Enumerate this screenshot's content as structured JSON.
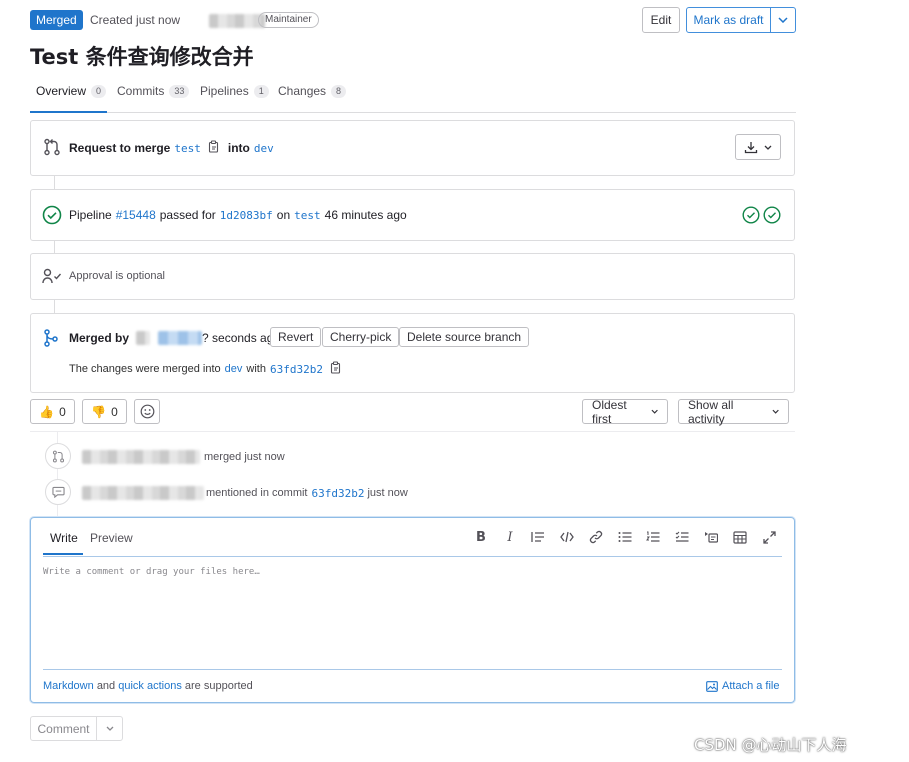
{
  "header": {
    "status_badge": "Merged",
    "created_text": "Created just now",
    "role_badge": "Maintainer",
    "edit_label": "Edit",
    "draft_label": "Mark as draft",
    "title": "Test 条件查询修改合并"
  },
  "tabs": [
    {
      "label": "Overview",
      "count": "0"
    },
    {
      "label": "Commits",
      "count": "33"
    },
    {
      "label": "Pipelines",
      "count": "1"
    },
    {
      "label": "Changes",
      "count": "8"
    }
  ],
  "merge_request": {
    "request_label": "Request to merge",
    "source_branch": "test",
    "into_label": "into",
    "target_branch": "dev"
  },
  "pipeline": {
    "label": "Pipeline",
    "id": "#15448",
    "passed_for": "passed for",
    "commit": "1d2083bf",
    "on": "on",
    "branch": "test",
    "time": "46 minutes ago"
  },
  "approval": {
    "text": "Approval is optional"
  },
  "merged": {
    "by_label": "Merged by",
    "time": "? seconds ago",
    "revert": "Revert",
    "cherry_pick": "Cherry-pick",
    "delete_branch": "Delete source branch",
    "changes_text": "The changes were merged into",
    "target_branch": "dev",
    "with": "with",
    "commit": "63fd32b2"
  },
  "reactions": {
    "thumbs_up": "0",
    "thumbs_down": "0",
    "sort_label": "Oldest first",
    "filter_label": "Show all activity"
  },
  "activity": [
    {
      "text": "merged just now"
    },
    {
      "text": "mentioned in commit",
      "commit": "63fd32b2",
      "suffix": "just now"
    }
  ],
  "editor": {
    "write_tab": "Write",
    "preview_tab": "Preview",
    "placeholder": "Write a comment or drag your files here…",
    "markdown_link": "Markdown",
    "and_text": "and",
    "quick_actions_link": "quick actions",
    "supported_text": "are supported",
    "attach_label": "Attach a file"
  },
  "comment_button": "Comment",
  "watermark": "CSDN @心动山下人海"
}
